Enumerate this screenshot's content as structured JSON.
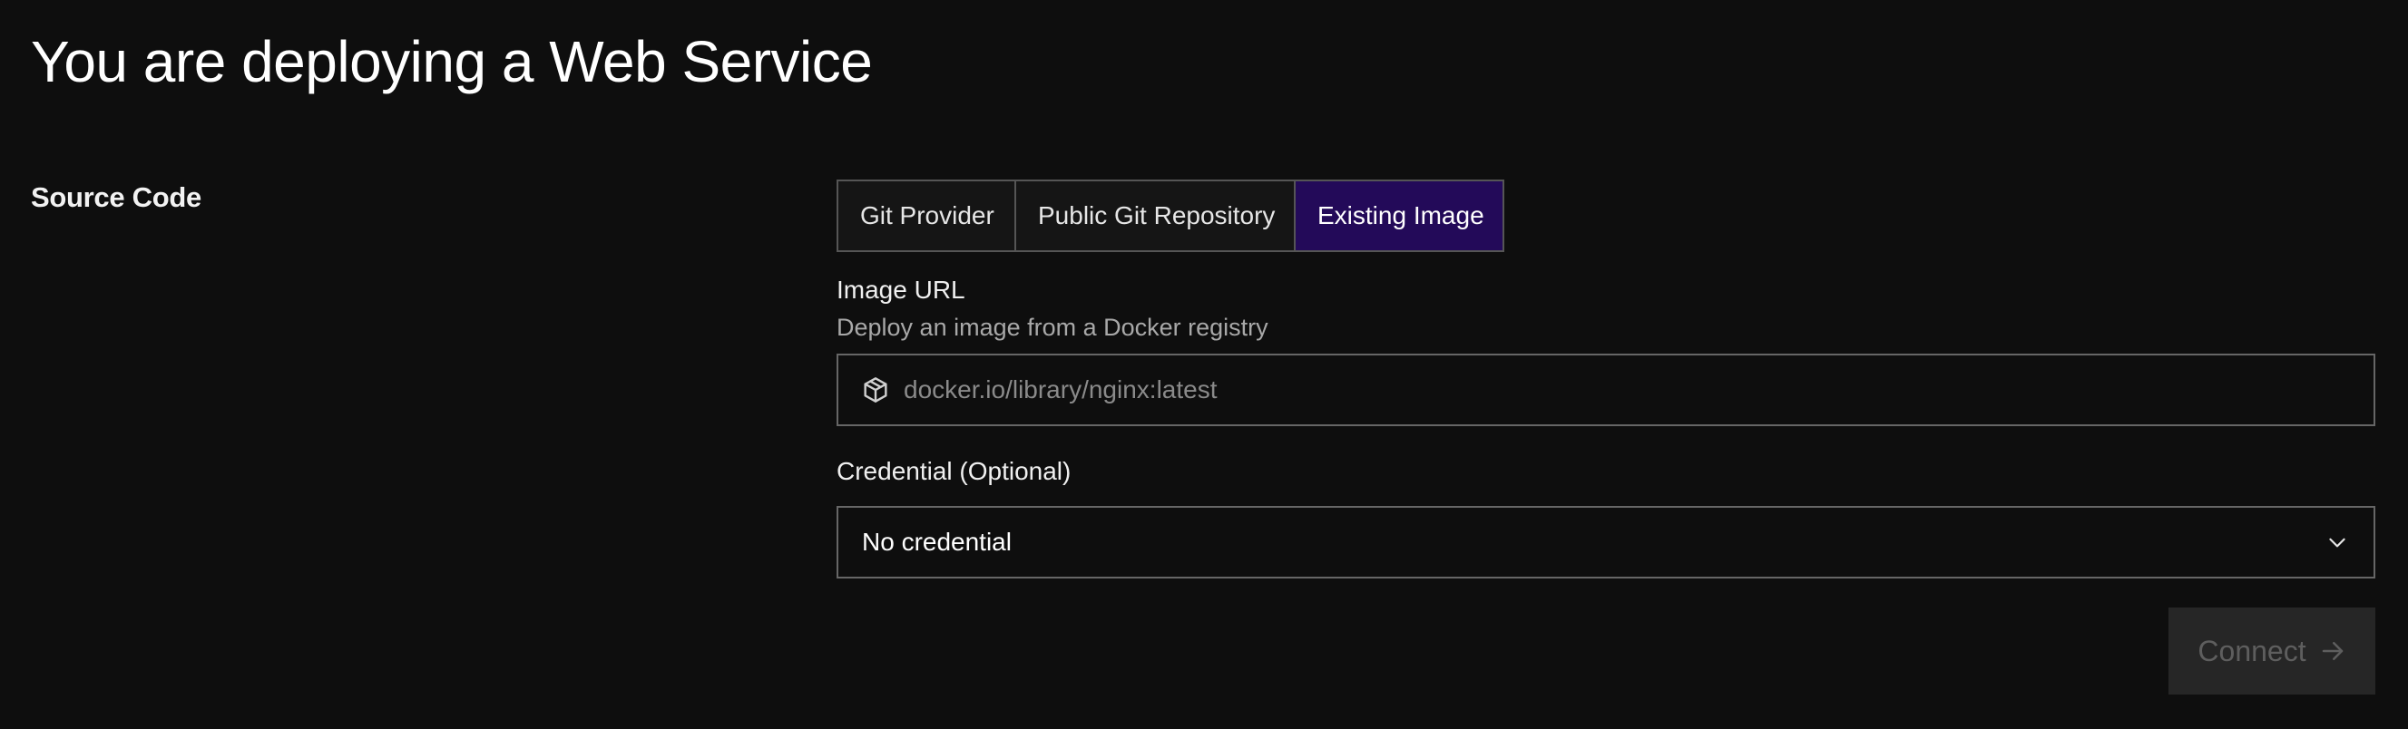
{
  "header": {
    "title": "You are deploying a Web Service"
  },
  "source_code": {
    "section_label": "Source Code",
    "tabs": [
      {
        "label": "Git Provider",
        "active": false
      },
      {
        "label": "Public Git Repository",
        "active": false
      },
      {
        "label": "Existing Image",
        "active": true
      }
    ],
    "image_url": {
      "label": "Image URL",
      "help": "Deploy an image from a Docker registry",
      "placeholder": "docker.io/library/nginx:latest",
      "value": "",
      "icon": "cube-icon"
    },
    "credential": {
      "label": "Credential (Optional)",
      "selected": "No credential",
      "icon": "chevron-down-icon"
    },
    "connect_button": {
      "label": "Connect",
      "disabled": true,
      "icon": "arrow-right-icon"
    }
  },
  "colors": {
    "background": "#0e0e0e",
    "active_tab": "#230a59",
    "border": "#666666",
    "disabled_button": "#262626"
  }
}
